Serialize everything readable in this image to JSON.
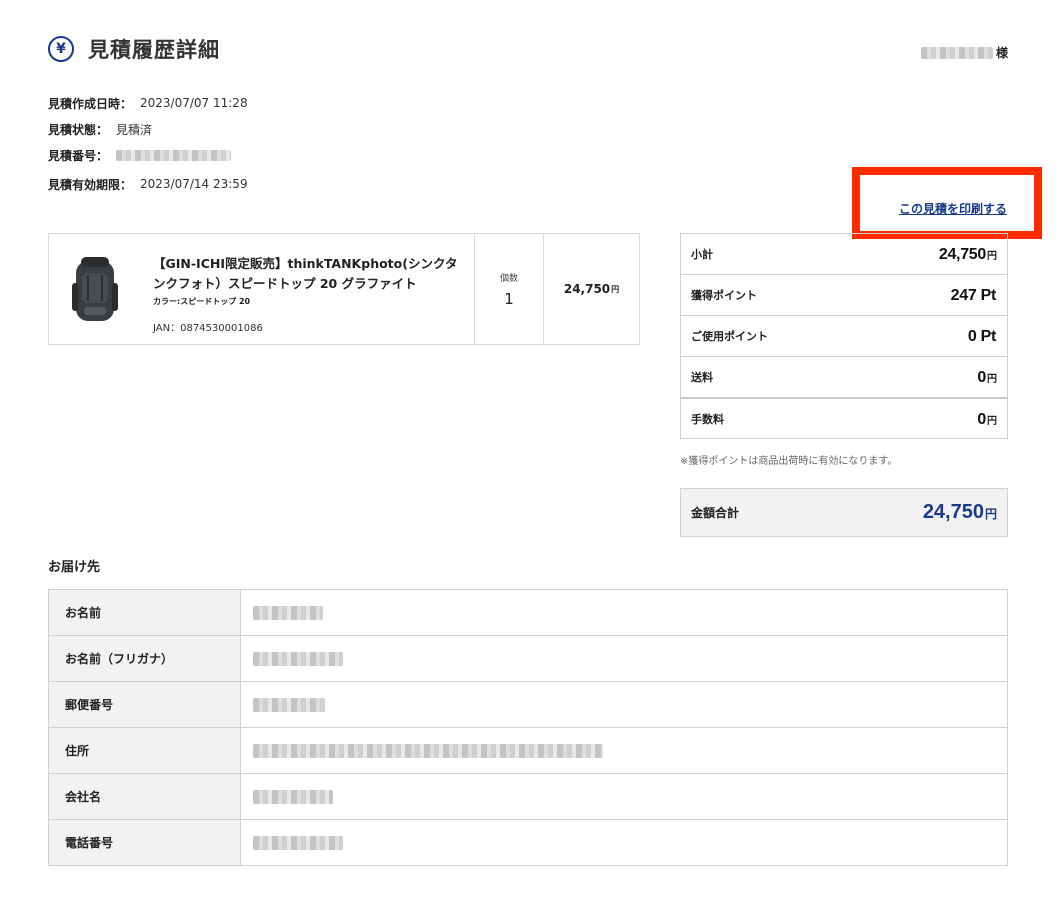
{
  "header": {
    "icon": "yen-circle-icon",
    "title": "見積履歴詳細",
    "customer_suffix": "様"
  },
  "meta": {
    "created_label": "見積作成日時：",
    "created_value": "2023/07/07 11:28",
    "status_label": "見積状態：",
    "status_value": "見積済",
    "number_label": "見積番号：",
    "expiry_label": "見積有効期限：",
    "expiry_value": "2023/07/14 23:59"
  },
  "print_link": "この見積を印刷する",
  "highlight_color": "#ff2a00",
  "product": {
    "name": "【GIN-ICHI限定販売】thinkTANKphoto(シンクタンクフォト）スピードトップ 20 グラファイト",
    "color": "カラー:スピードトップ 20",
    "jan": "JAN：0874530001086",
    "qty_label": "個数",
    "qty": "1",
    "price": "24,750",
    "price_unit": "円"
  },
  "summary": {
    "rows": [
      {
        "label": "小計",
        "value": "24,750",
        "unit": "円"
      },
      {
        "label": "獲得ポイント",
        "value": "247 Pt",
        "unit": ""
      },
      {
        "label": "ご使用ポイント",
        "value": "0 Pt",
        "unit": ""
      },
      {
        "label": "送料",
        "value": "0",
        "unit": "円"
      },
      {
        "label": "手数料",
        "value": "0",
        "unit": "円"
      }
    ],
    "note": "※獲得ポイントは商品出荷時に有効になります。",
    "total_label": "金額合計",
    "total_value": "24,750",
    "total_unit": "円"
  },
  "delivery": {
    "title": "お届け先",
    "rows": [
      {
        "label": "お名前"
      },
      {
        "label": "お名前（フリガナ）"
      },
      {
        "label": "郵便番号"
      },
      {
        "label": "住所"
      },
      {
        "label": "会社名"
      },
      {
        "label": "電話番号"
      }
    ]
  },
  "colors": {
    "accent": "#1b3a8c",
    "border": "#d0d0d0",
    "label_bg": "#f2f2f2"
  }
}
